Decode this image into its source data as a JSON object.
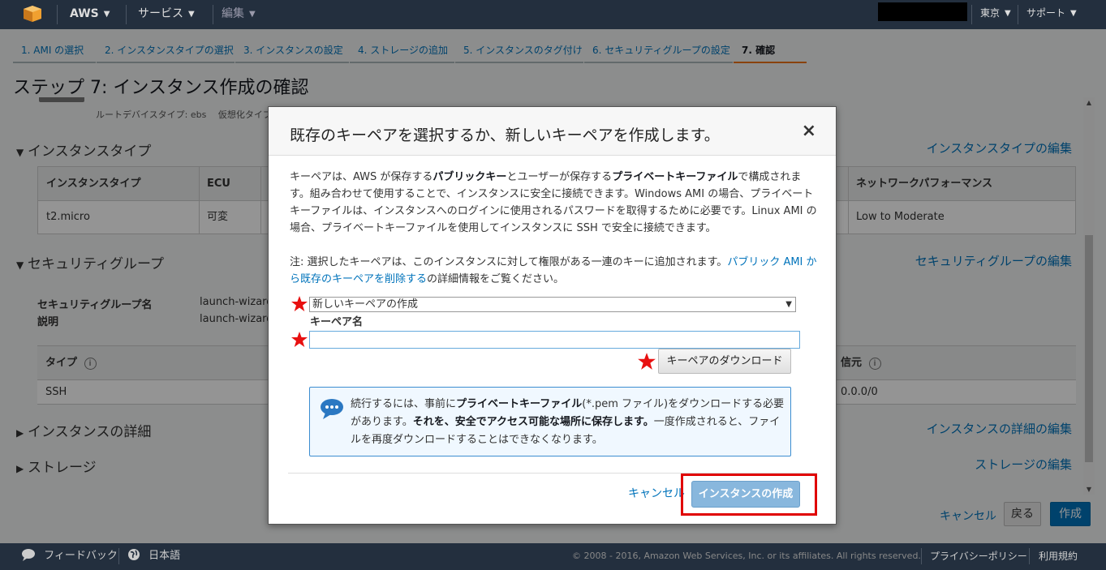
{
  "nav": {
    "aws_label": "AWS",
    "services_label": "サービス",
    "edit_label": "編集",
    "region_label": "東京",
    "support_label": "サポート"
  },
  "wizard_tabs": [
    {
      "label": "1. AMI の選択"
    },
    {
      "label": "2. インスタンスタイプの選択"
    },
    {
      "label": "3. インスタンスの設定"
    },
    {
      "label": "4. ストレージの追加"
    },
    {
      "label": "5. インスタンスのタグ付け"
    },
    {
      "label": "6. セキュリティグループの設定"
    },
    {
      "label": "7. 確認"
    }
  ],
  "page_title": "ステップ 7: インスタンス作成の確認",
  "background": {
    "ami_partial_text": "ルートデバイスタイプ: ebs　 仮想化タイプ: h",
    "instance_type": {
      "heading": "インスタンスタイプ",
      "edit": "インスタンスタイプの編集",
      "columns": [
        "インスタンスタイプ",
        "ECU",
        "ネットワークパフォーマンス"
      ],
      "row": [
        "t2.micro",
        "可変",
        "Low to Moderate"
      ]
    },
    "security_group": {
      "heading": "セキュリティグループ",
      "edit": "セキュリティグループの編集",
      "name_label": "セキュリティグループ名",
      "name_value": "launch-wizard",
      "desc_label": "説明",
      "desc_value": "launch-wizard",
      "columns": [
        "タイプ",
        "信元"
      ],
      "row": [
        "SSH",
        "0.0.0/0"
      ]
    },
    "instance_details": {
      "heading": "インスタンスの詳細",
      "edit": "インスタンスの詳細の編集"
    },
    "storage": {
      "heading": "ストレージ",
      "edit": "ストレージの編集"
    }
  },
  "bottom_buttons": {
    "cancel": "キャンセル",
    "back": "戻る",
    "launch": "作成"
  },
  "modal": {
    "title": "既存のキーペアを選択するか、新しいキーペアを作成します。",
    "close": "×",
    "p1_a": "キーペアは、AWS が保存する",
    "p1_b": "パブリックキー",
    "p1_c": "とユーザーが保存する",
    "p1_d": "プライベートキーファイル",
    "p1_e": "で構成されます。組み合わせて使用することで、インスタンスに安全に接続できます。Windows AMI の場合、プライベートキーファイルは、インスタンスへのログインに使用されるパスワードを取得するために必要です。Linux AMI の場合、プライベートキーファイルを使用してインスタンスに SSH で安全に接続できます。",
    "note_a": "注: 選択したキーペアは、このインスタンスに対して権限がある一連のキーに追加されます。",
    "note_link": "パブリック AMI から既存のキーペアを削除する",
    "note_b": "の詳細情報をご覧ください。",
    "keypair_option": "新しいキーペアの作成",
    "keyname_label": "キーペア名",
    "keyname_value": "",
    "download_button": "キーペアのダウンロード",
    "info_a": "続行するには、事前に",
    "info_b": "プライベートキーファイル",
    "info_c": "(*.pem ファイル)をダウンロードする必要があります。",
    "info_d": "それを、安全でアクセス可能な場所に保存します。",
    "info_e": "一度作成されると、ファイルを再度ダウンロードすることはできなくなります。",
    "cancel": "キャンセル",
    "create": "インスタンスの作成"
  },
  "footer": {
    "feedback": "フィードバック",
    "language": "日本語",
    "copyright": "© 2008 - 2016, Amazon Web Services, Inc. or its affiliates. All rights reserved.",
    "privacy": "プライバシーポリシー",
    "terms": "利用規約"
  },
  "colors": {
    "nav_bg": "#232f3e",
    "link": "#0073bb",
    "highlight": "#e00000",
    "star": "#e81010"
  }
}
